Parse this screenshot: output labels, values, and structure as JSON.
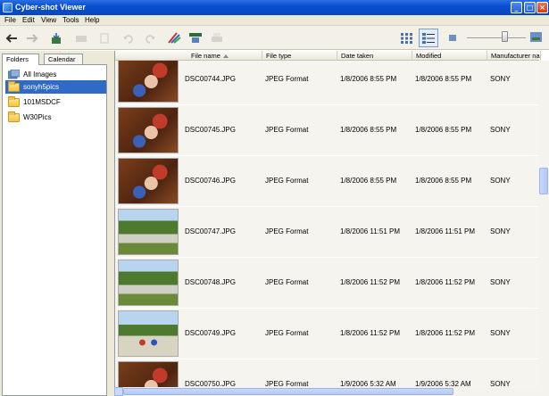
{
  "window": {
    "title": "Cyber-shot Viewer",
    "controls": {
      "minimize": "_",
      "maximize": "□",
      "close": "×"
    }
  },
  "menu": [
    "File",
    "Edit",
    "View",
    "Tools",
    "Help"
  ],
  "toolbar": {
    "buttons": [
      {
        "name": "back-button",
        "icon": "arrow-left-icon",
        "enabled": true
      },
      {
        "name": "forward-button",
        "icon": "arrow-right-icon",
        "enabled": false
      },
      {
        "name": "import-button",
        "icon": "import-icon",
        "enabled": true
      },
      {
        "name": "delete-button",
        "icon": "trash-icon",
        "enabled": false
      },
      {
        "name": "copy-button",
        "icon": "copy-icon",
        "enabled": false
      },
      {
        "name": "rotate-left-button",
        "icon": "rotate-left-icon",
        "enabled": false
      },
      {
        "name": "rotate-right-button",
        "icon": "rotate-right-icon",
        "enabled": false
      },
      {
        "name": "edit-button",
        "icon": "edit-icon",
        "enabled": true
      },
      {
        "name": "slideshow-button",
        "icon": "slideshow-icon",
        "enabled": true
      },
      {
        "name": "print-button",
        "icon": "print-icon",
        "enabled": false
      }
    ],
    "view_buttons": [
      {
        "name": "thumbnail-view-button",
        "icon": "grid-icon",
        "active": false
      },
      {
        "name": "details-view-button",
        "icon": "list-icon",
        "active": true
      }
    ],
    "zoom": {
      "min_icon": "small-image-icon",
      "max_icon": "large-image-icon",
      "level": 0.7
    }
  },
  "left_pane": {
    "tabs": [
      {
        "label": "Folders",
        "active": true
      },
      {
        "label": "Calendar",
        "active": false
      }
    ],
    "tree": [
      {
        "label": "All Images",
        "icon": "all-images-icon",
        "selected": false
      },
      {
        "label": "sonyh5pics",
        "icon": "folder-icon",
        "selected": true
      },
      {
        "label": "101MSDCF",
        "icon": "folder-icon",
        "selected": false
      },
      {
        "label": "W30Pics",
        "icon": "folder-icon",
        "selected": false
      }
    ]
  },
  "list": {
    "columns": [
      "File name",
      "File type",
      "Date taken",
      "Modified",
      "Manufacturer name"
    ],
    "sorted_column": "File name",
    "rows": [
      {
        "file": "DSC00744.JPG",
        "type": "JPEG Format",
        "taken": "1/8/2006 8:55 PM",
        "modified": "1/8/2006 8:55 PM",
        "maker": "SONY",
        "thumb": "indoor-baby"
      },
      {
        "file": "DSC00745.JPG",
        "type": "JPEG Format",
        "taken": "1/8/2006 8:55 PM",
        "modified": "1/8/2006 8:55 PM",
        "maker": "SONY",
        "thumb": "indoor-baby"
      },
      {
        "file": "DSC00746.JPG",
        "type": "JPEG Format",
        "taken": "1/8/2006 8:55 PM",
        "modified": "1/8/2006 8:55 PM",
        "maker": "SONY",
        "thumb": "indoor-baby"
      },
      {
        "file": "DSC00747.JPG",
        "type": "JPEG Format",
        "taken": "1/8/2006 11:51 PM",
        "modified": "1/8/2006 11:51 PM",
        "maker": "SONY",
        "thumb": "outdoor-park"
      },
      {
        "file": "DSC00748.JPG",
        "type": "JPEG Format",
        "taken": "1/8/2006 11:52 PM",
        "modified": "1/8/2006 11:52 PM",
        "maker": "SONY",
        "thumb": "outdoor-park"
      },
      {
        "file": "DSC00749.JPG",
        "type": "JPEG Format",
        "taken": "1/8/2006 11:52 PM",
        "modified": "1/8/2006 11:52 PM",
        "maker": "SONY",
        "thumb": "outdoor-kids"
      },
      {
        "file": "DSC00750.JPG",
        "type": "JPEG Format",
        "taken": "1/9/2006 5:32 AM",
        "modified": "1/9/2006 5:32 AM",
        "maker": "SONY",
        "thumb": "indoor-baby"
      }
    ]
  },
  "colors": {
    "titlebar": "#0a4fd0",
    "selection": "#316ac5",
    "row_bg": "#f5f4ee",
    "chrome": "#ece9d8"
  }
}
